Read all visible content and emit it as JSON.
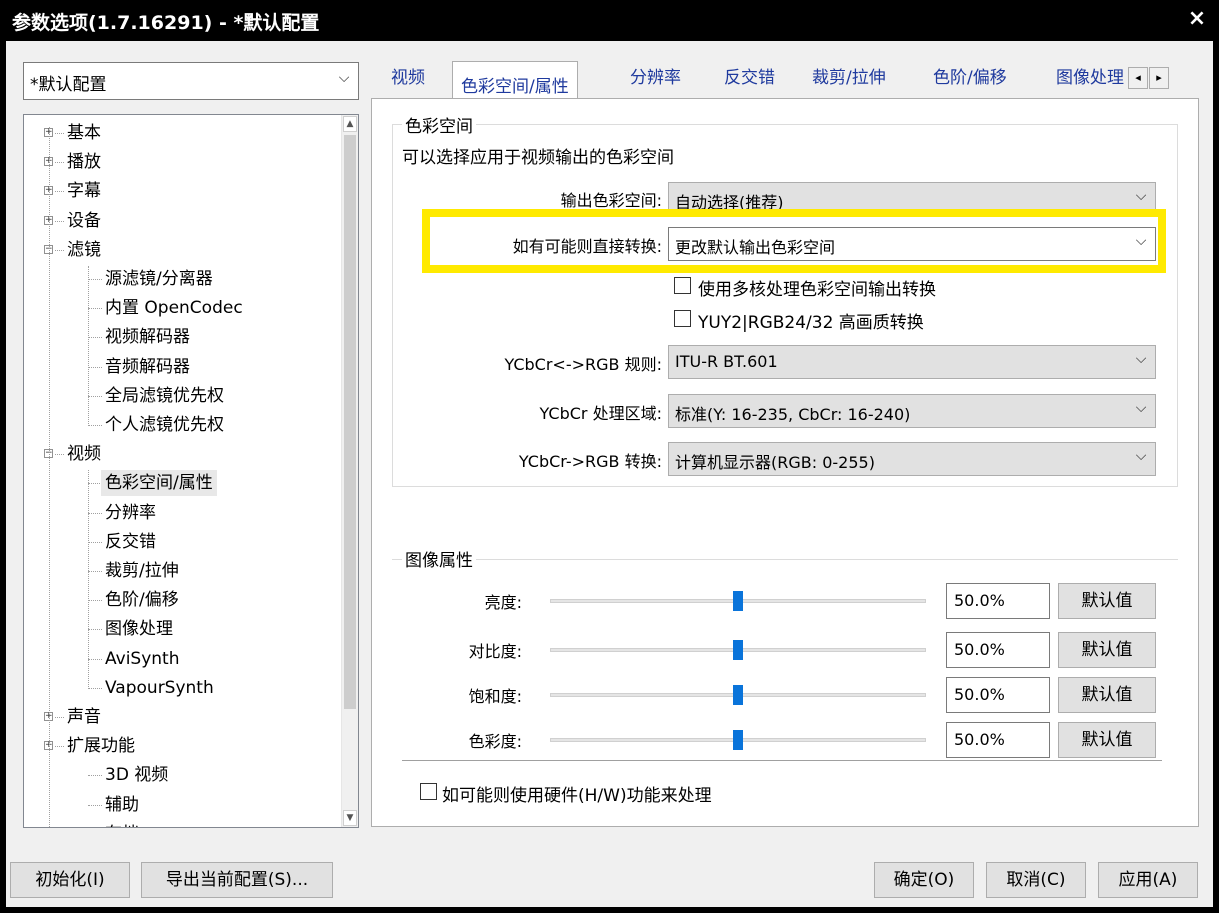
{
  "window": {
    "title": "参数选项(1.7.16291) - *默认配置",
    "close": "×"
  },
  "profile": {
    "value": "*默认配置"
  },
  "tabs": [
    "视频",
    "色彩空间/属性",
    "分辨率",
    "反交错",
    "裁剪/拉伸",
    "色阶/偏移",
    "图像处理"
  ],
  "tab_nav": {
    "left": "◂",
    "right": "▸"
  },
  "tree": {
    "items": [
      {
        "label": "基本",
        "exp": "+"
      },
      {
        "label": "播放",
        "exp": "+"
      },
      {
        "label": "字幕",
        "exp": "+"
      },
      {
        "label": "设备",
        "exp": "+"
      },
      {
        "label": "滤镜",
        "exp": "−"
      },
      {
        "label": "源滤镜/分离器"
      },
      {
        "label": "内置 OpenCodec"
      },
      {
        "label": "视频解码器"
      },
      {
        "label": "音频解码器"
      },
      {
        "label": "全局滤镜优先权"
      },
      {
        "label": "个人滤镜优先权"
      },
      {
        "label": "视频",
        "exp": "−"
      },
      {
        "label": "色彩空间/属性"
      },
      {
        "label": "分辨率"
      },
      {
        "label": "反交错"
      },
      {
        "label": "裁剪/拉伸"
      },
      {
        "label": "色阶/偏移"
      },
      {
        "label": "图像处理"
      },
      {
        "label": "AviSynth"
      },
      {
        "label": "VapourSynth"
      },
      {
        "label": "声音",
        "exp": "+"
      },
      {
        "label": "扩展功能",
        "exp": "+"
      },
      {
        "label": "3D 视频"
      },
      {
        "label": "辅助"
      },
      {
        "label": "存档"
      }
    ]
  },
  "colorspace": {
    "group": "色彩空间",
    "desc": "可以选择应用于视频输出的色彩空间",
    "output_label": "输出色彩空间:",
    "output_value": "自动选择(推荐)",
    "direct_label": "如有可能则直接转换:",
    "direct_value": "更改默认输出色彩空间",
    "multicore": "使用多核处理色彩空间输出转换",
    "yuy2": "YUY2|RGB24/32 高画质转换",
    "rule_label": "YCbCr<->RGB 规则:",
    "rule_value": "ITU-R BT.601",
    "range_label": "YCbCr 处理区域:",
    "range_value": "标准(Y: 16-235, CbCr: 16-240)",
    "conv_label": "YCbCr->RGB 转换:",
    "conv_value": "计算机显示器(RGB: 0-255)"
  },
  "image_props": {
    "group": "图像属性",
    "rows": [
      {
        "label": "亮度:",
        "value": "50.0%",
        "level": 0.5,
        "btn": "默认值"
      },
      {
        "label": "对比度:",
        "value": "50.0%",
        "level": 0.5,
        "btn": "默认值"
      },
      {
        "label": "饱和度:",
        "value": "50.0%",
        "level": 0.5,
        "btn": "默认值"
      },
      {
        "label": "色彩度:",
        "value": "50.0%",
        "level": 0.5,
        "btn": "默认值"
      }
    ]
  },
  "hw": "如可能则使用硬件(H/W)功能来处理",
  "buttons": {
    "init": "初始化(I)",
    "export": "导出当前配置(S)...",
    "ok": "确定(O)",
    "cancel": "取消(C)",
    "apply": "应用(A)"
  },
  "colors": {
    "highlight": "#ffea00",
    "slider_thumb": "#0a74da",
    "tab_text": "#1f3a9e"
  }
}
